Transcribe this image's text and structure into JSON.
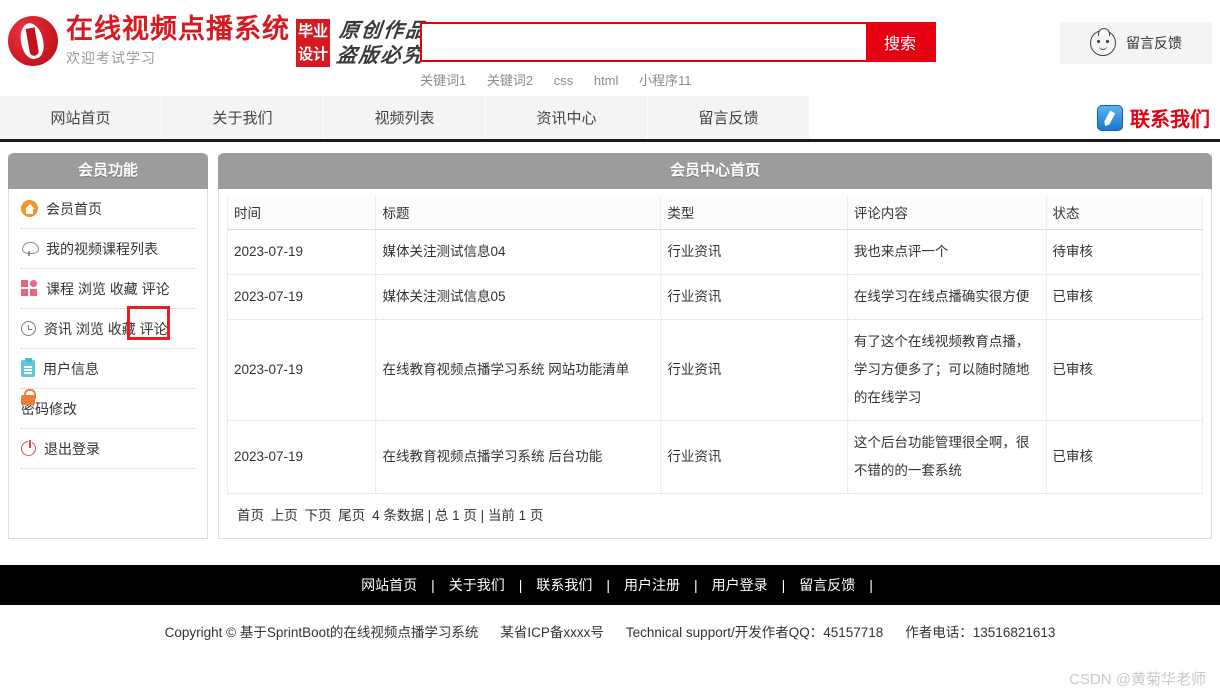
{
  "header": {
    "logo": {
      "mark_icon": "circle-j-logo-icon",
      "title": "在线视频点播系统",
      "subtitle": "欢迎考试学习",
      "badge_line1": "毕业",
      "badge_line2": "设计",
      "calligraphy_line1": "原创作品",
      "calligraphy_line2": "盗版必究"
    },
    "search": {
      "value": "",
      "placeholder": "",
      "button_label": "搜索",
      "keywords": [
        "关键词1",
        "关键词2",
        "css",
        "html",
        "小程序11"
      ]
    },
    "feedback_button": {
      "icon": "face-avatar-icon",
      "label": "留言反馈"
    }
  },
  "nav": {
    "items": [
      "网站首页",
      "关于我们",
      "视频列表",
      "资讯中心",
      "留言反馈"
    ],
    "contact": {
      "icon": "pen-square-icon",
      "label": "联系我们"
    }
  },
  "sidebar": {
    "title": "会员功能",
    "items": [
      {
        "label": "会员首页",
        "icon": "home-circle-icon"
      },
      {
        "label": "我的视频课程列表",
        "icon": "flower-icon"
      },
      {
        "label": "课程 浏览 收藏 评论",
        "icon": "grid-squares-icon"
      },
      {
        "label": "资讯 浏览 收藏 评论",
        "icon": "clock-icon"
      },
      {
        "label": "用户信息",
        "icon": "clipboard-icon"
      },
      {
        "label": "密码修改",
        "icon": "lock-icon"
      },
      {
        "label": "退出登录",
        "icon": "power-icon"
      }
    ],
    "highlight": {
      "target": "评论",
      "color": "#ec1c24"
    }
  },
  "main": {
    "title": "会员中心首页",
    "table": {
      "columns": [
        "时间",
        "标题",
        "类型",
        "评论内容",
        "状态"
      ],
      "rows": [
        {
          "time": "2023-07-19",
          "title": "媒体关注测试信息04",
          "type": "行业资讯",
          "comment": "我也来点评一个",
          "status": "待审核",
          "status_state": "pending"
        },
        {
          "time": "2023-07-19",
          "title": "媒体关注测试信息05",
          "type": "行业资讯",
          "comment": "在线学习在线点播确实很方便",
          "status": "已审核",
          "status_state": "approved"
        },
        {
          "time": "2023-07-19",
          "title": "在线教育视频点播学习系统 网站功能清单",
          "type": "行业资讯",
          "comment": "有了这个在线视频教育点播，学习方便多了；可以随时随地的在线学习",
          "status": "已审核",
          "status_state": "approved"
        },
        {
          "time": "2023-07-19",
          "title": "在线教育视频点播学习系统 后台功能",
          "type": "行业资讯",
          "comment": "这个后台功能管理很全啊，很不错的的一套系统",
          "status": "已审核",
          "status_state": "approved"
        }
      ]
    },
    "pager": {
      "first": "首页",
      "prev": "上页",
      "next": "下页",
      "last": "尾页",
      "summary": "4 条数据 | 总 1 页 | 当前 1 页"
    }
  },
  "footer": {
    "links": [
      "网站首页",
      "关于我们",
      "联系我们",
      "用户注册",
      "用户登录",
      "留言反馈"
    ],
    "separator": "|",
    "copyright": "Copyright © 基于SprintBoot的在线视频点播学习系统",
    "icp": "某省ICP备xxxx号",
    "support": "Technical support/开发作者QQ：45157718",
    "phone": "作者电话：13516821613"
  },
  "watermark": "CSDN @黄菊华老师",
  "colors": {
    "brand_red": "#d71921",
    "search_red": "#e60012",
    "gray_head": "#9c9c9c",
    "highlight": "#ec1c24"
  }
}
